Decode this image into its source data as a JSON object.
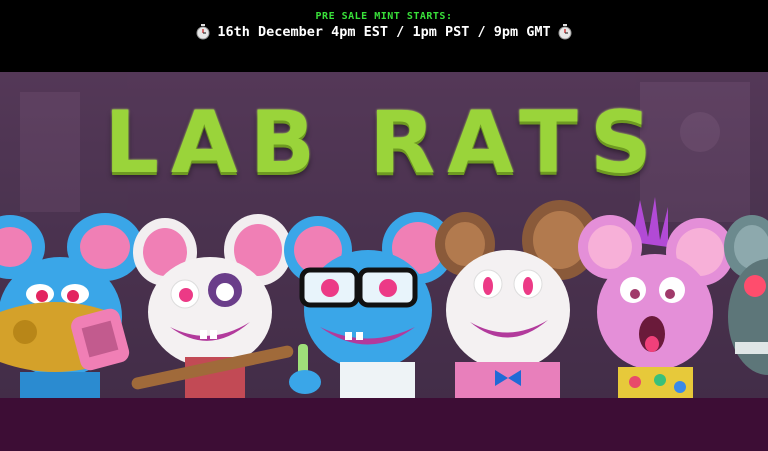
{
  "banner": {
    "presale_label": "PRE SALE MINT STARTS:",
    "schedule": "16th December 4pm EST / 1pm PST / 9pm GMT",
    "icons": [
      "stopwatch-icon",
      "stopwatch-icon"
    ]
  },
  "hero": {
    "title": "LAB RATS",
    "title_color": "#9ad43a"
  },
  "colors": {
    "presale_green": "#39e03a",
    "background_purple": "#4c3350",
    "footer_purple": "#3d0d35"
  }
}
